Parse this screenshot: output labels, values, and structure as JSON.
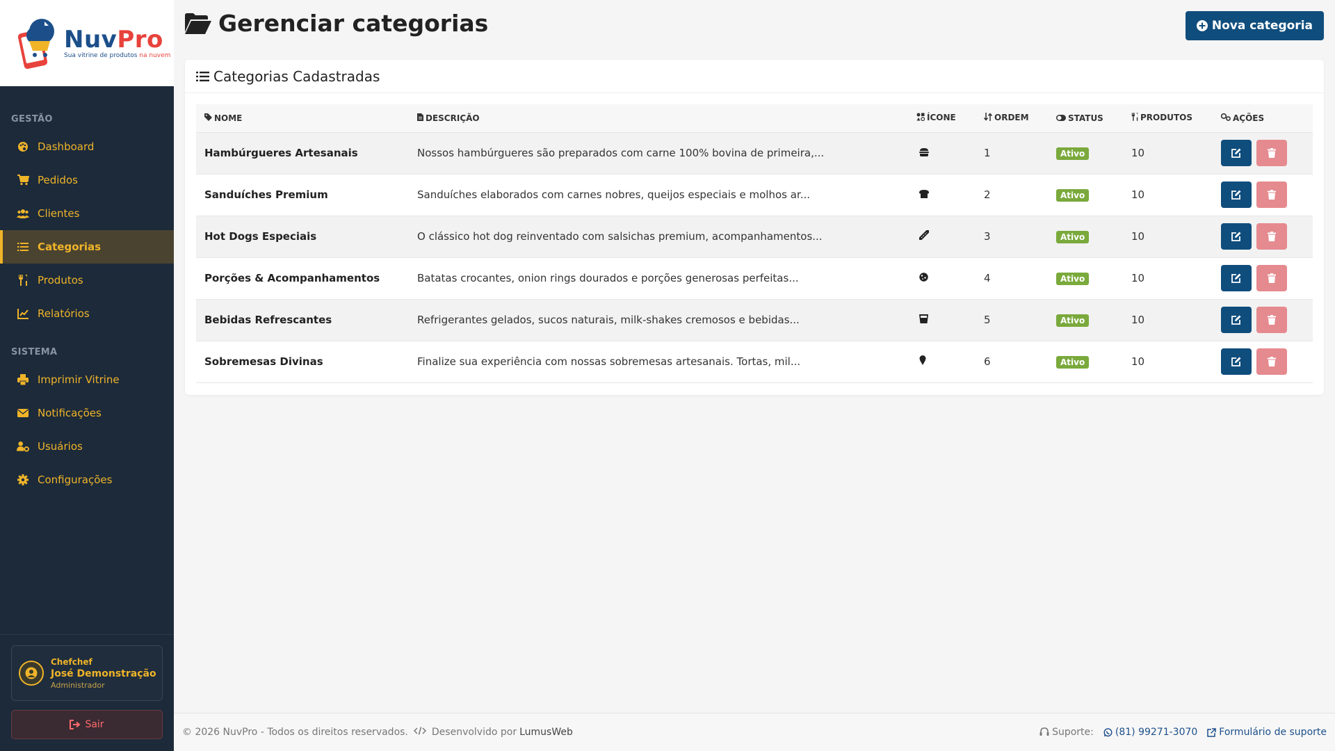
{
  "brand": {
    "name_part1": "Nuv",
    "name_part2": "Pro",
    "tagline_part1": "Sua vitrine de produtos ",
    "tagline_part2": "na nuvem"
  },
  "sidebar": {
    "section_gestao": "GESTÃO",
    "gestao_items": [
      {
        "label": "Dashboard",
        "icon": "palette-icon"
      },
      {
        "label": "Pedidos",
        "icon": "cart-icon"
      },
      {
        "label": "Clientes",
        "icon": "users-icon"
      },
      {
        "label": "Categorias",
        "icon": "list-icon",
        "active": true
      },
      {
        "label": "Produtos",
        "icon": "utensils-icon"
      },
      {
        "label": "Relatórios",
        "icon": "chart-icon"
      }
    ],
    "section_sistema": "SISTEMA",
    "sistema_items": [
      {
        "label": "Imprimir Vitrine",
        "icon": "printer-icon"
      },
      {
        "label": "Notificações",
        "icon": "envelope-icon"
      },
      {
        "label": "Usuários",
        "icon": "user-gear-icon"
      },
      {
        "label": "Configurações",
        "icon": "gear-icon"
      }
    ],
    "user": {
      "company": "Chefchef",
      "name": "José Demonstração",
      "role": "Administrador"
    },
    "logout_label": "Sair"
  },
  "page": {
    "title": "Gerenciar categorias",
    "new_button": "Nova categoria",
    "card_title": "Categorias Cadastradas"
  },
  "table": {
    "headers": {
      "name": "NOME",
      "description": "DESCRIÇÃO",
      "icon": "ÍCONE",
      "order": "ORDEM",
      "status": "STATUS",
      "products": "PRODUTOS",
      "actions": "AÇÕES"
    },
    "rows": [
      {
        "name": "Hambúrgueres Artesanais",
        "description": "Nossos hambúrgueres são preparados com carne 100% bovina de primeira,...",
        "icon": "burger-icon",
        "order": "1",
        "status": "Ativo",
        "products": "10"
      },
      {
        "name": "Sanduíches Premium",
        "description": "Sanduíches elaborados com carnes nobres, queijos especiais e molhos ar...",
        "icon": "bread-icon",
        "order": "2",
        "status": "Ativo",
        "products": "10"
      },
      {
        "name": "Hot Dogs Especiais",
        "description": "O clássico hot dog reinventado com salsichas premium, acompanhamentos...",
        "icon": "hotdog-icon",
        "order": "3",
        "status": "Ativo",
        "products": "10"
      },
      {
        "name": "Porções & Acompanhamentos",
        "description": "Batatas crocantes, onion rings dourados e porções generosas perfeitas...",
        "icon": "cookie-icon",
        "order": "4",
        "status": "Ativo",
        "products": "10"
      },
      {
        "name": "Bebidas Refrescantes",
        "description": "Refrigerantes gelados, sucos naturais, milk-shakes cremosos e bebidas...",
        "icon": "glass-icon",
        "order": "5",
        "status": "Ativo",
        "products": "10"
      },
      {
        "name": "Sobremesas Divinas",
        "description": "Finalize sua experiência com nossas sobremesas artesanais. Tortas, mil...",
        "icon": "ice-cream-icon",
        "order": "6",
        "status": "Ativo",
        "products": "10"
      }
    ]
  },
  "footer": {
    "copyright": "© 2026 NuvPro - Todos os direitos reservados.",
    "dev_label": "Desenvolvido por",
    "dev_name": "LumusWeb",
    "support_label": "Suporte:",
    "phone": "(81) 99271-3070",
    "form_link": "Formulário de suporte"
  },
  "colors": {
    "sidebar_bg": "#1c2a3a",
    "accent": "#f0b429",
    "primary": "#0f4d7d",
    "danger": "#e58a8f",
    "success": "#7aa93c"
  }
}
